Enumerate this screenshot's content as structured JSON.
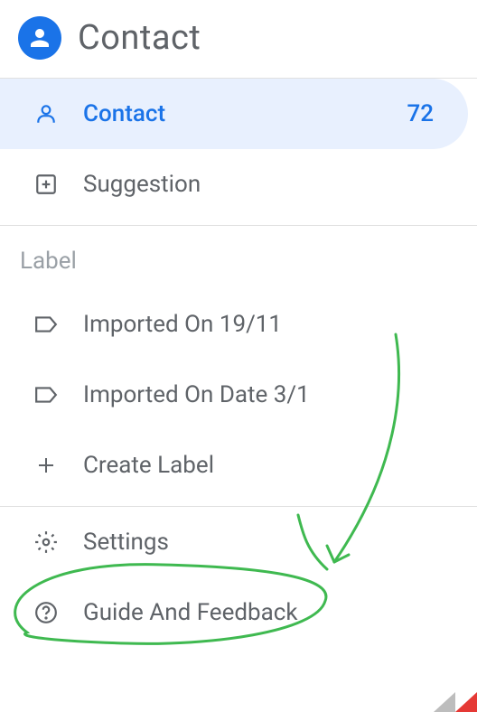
{
  "header": {
    "title": "Contact"
  },
  "nav": {
    "contact": {
      "label": "Contact",
      "count": "72"
    },
    "suggestion": {
      "label": "Suggestion"
    }
  },
  "labels": {
    "heading": "Label",
    "items": [
      {
        "label": "Imported On 19/11"
      },
      {
        "label": "Imported On Date 3/1"
      }
    ],
    "create": "Create Label"
  },
  "footer": {
    "settings": "Settings",
    "guide": "Guide And Feedback"
  },
  "colors": {
    "accent": "#1a73e8",
    "annotation": "#3fb950"
  }
}
